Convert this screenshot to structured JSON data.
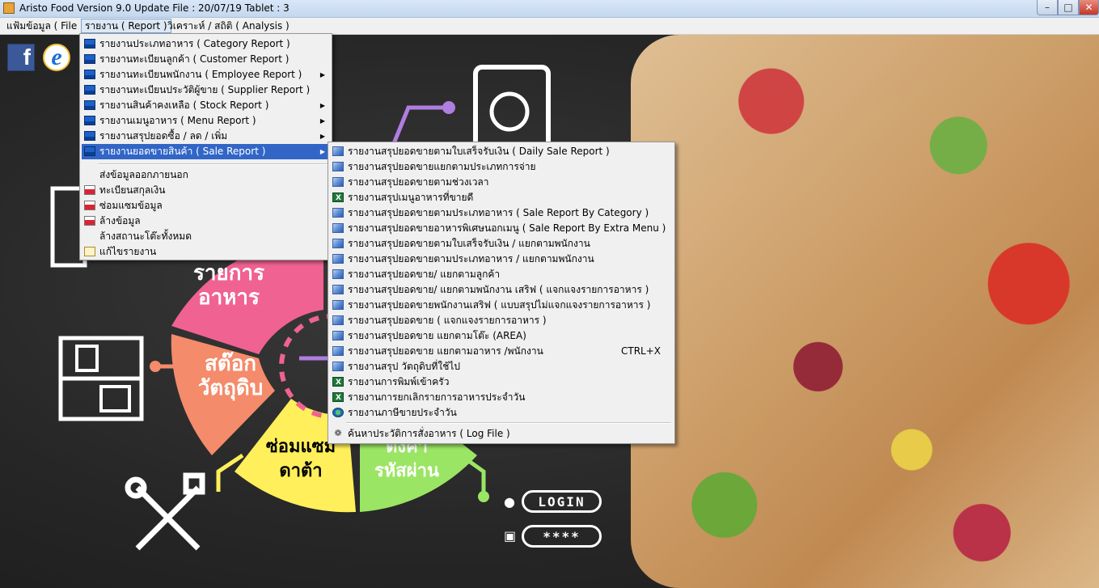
{
  "window": {
    "title": "Aristo Food  Version 9.0 Update File : 20/07/19 Tablet  : 3",
    "min_label": "–",
    "max_label": "□",
    "close_label": "✕"
  },
  "menubar": {
    "items": [
      {
        "label": "แฟ้มข้อมูล ( File )"
      },
      {
        "label": "รายงาน ( Report )"
      },
      {
        "label": "วิเคราะห์ / สถิติ ( Analysis )"
      }
    ]
  },
  "social": {
    "facebook": "f",
    "ie": "e"
  },
  "wheel": {
    "food_list": "รายการ\nอาหาร",
    "stock": "สต๊อก\nวัตถุดิบ",
    "repair": "ซ่อมแซม\nดาต้า",
    "password": "ตั้งค่า\nรหัสผ่าน"
  },
  "login": {
    "login_label": "LOGIN",
    "password_label": "****"
  },
  "report_menu": {
    "items": [
      {
        "label": "รายงานประเภทอาหาร ( Category Report )",
        "icon": "monitor-icon"
      },
      {
        "label": "รายงานทะเบียนลูกค้า ( Customer Report )",
        "icon": "monitor-icon"
      },
      {
        "label": "รายงานทะเบียนพนักงาน ( Employee Report )",
        "icon": "monitor-icon",
        "submenu": true
      },
      {
        "label": "รายงานทะเบียนประวัติผู้ขาย ( Supplier Report )",
        "icon": "monitor-icon"
      },
      {
        "label": "รายงานสินค้าคงเหลือ ( Stock Report )",
        "icon": "monitor-icon",
        "submenu": true
      },
      {
        "label": "รายงานเมนูอาหาร ( Menu Report )",
        "icon": "monitor-icon",
        "submenu": true
      },
      {
        "label": "รายงานสรุปยอดซื้อ / ลด / เพิ่ม",
        "icon": "monitor-icon",
        "submenu": true
      },
      {
        "label": "รายงานยอดขายสินค้า ( Sale Report )",
        "icon": "monitor-icon",
        "submenu": true,
        "highlighted": true
      },
      {
        "label": "ส่งข้อมูลออกภายนอก",
        "icon": ""
      },
      {
        "label": "ทะเบียนสกุลเงิน",
        "icon": "currency-icon"
      },
      {
        "label": "ซ่อมแซมข้อมูล",
        "icon": "repair-icon"
      },
      {
        "label": "ล้างข้อมูล",
        "icon": "clear-icon"
      },
      {
        "label": "ล้างสถานะโต๊ะทั้งหมด",
        "icon": ""
      },
      {
        "label": "แก้ไขรายงาน",
        "icon": "edit-icon"
      }
    ]
  },
  "sale_submenu": {
    "items": [
      {
        "label": "รายงานสรุปยอดขายตามใบเสร็จรับเงิน ( Daily Sale Report )",
        "icon": "cube"
      },
      {
        "label": "รายงานสรุปยอดขายแยกตามประเภทการจ่าย",
        "icon": "cube"
      },
      {
        "label": "รายงานสรุปยอดขายตามช่วงเวลา",
        "icon": "cube"
      },
      {
        "label": "รายงานสรุปเมนูอาหารที่ขายดี",
        "icon": "excel"
      },
      {
        "label": "รายงานสรุปยอดขายตามประเภทอาหาร ( Sale Report By Category )",
        "icon": "cube"
      },
      {
        "label": "รายงานสรุปยอดขายอาหารพิเศษนอกเมนู ( Sale Report By Extra Menu )",
        "icon": "cube"
      },
      {
        "label": "รายงานสรุปยอดขายตามใบเสร็จรับเงิน / แยกตามพนักงาน",
        "icon": "cube"
      },
      {
        "label": "รายงานสรุปยอดขายตามประเภทอาหาร / แยกตามพนักงาน",
        "icon": "cube"
      },
      {
        "label": "รายงานสรุปยอดขาย/ แยกตามลูกค้า",
        "icon": "cube"
      },
      {
        "label": "รายงานสรุปยอดขาย/ แยกตามพนักงาน เสริฟ ( แจกแจงรายการอาหาร )",
        "icon": "cube"
      },
      {
        "label": "รายงานสรุปยอดขายพนักงานเสริฟ ( แบบสรุปไม่แจกแจงรายการอาหาร )",
        "icon": "cube"
      },
      {
        "label": "รายงานสรุปยอดขาย ( แจกแจงรายการอาหาร )",
        "icon": "cube"
      },
      {
        "label": "รายงานสรุปยอดขาย แยกตามโต๊ะ   (AREA)",
        "icon": "cube"
      },
      {
        "label": "รายงานสรุปยอดขาย แยกตามอาหาร /พนักงาน",
        "icon": "cube",
        "shortcut": "CTRL+X"
      },
      {
        "label": "รายงานสรุป วัตถุดิบที่ใช้ไป",
        "icon": "cube"
      },
      {
        "label": "รายงานการพิมพ์เข้าครัว",
        "icon": "excel"
      },
      {
        "label": "รายงานการยกเลิกรายการอาหารประจำวัน",
        "icon": "excel"
      },
      {
        "label": "รายงานภาษีขายประจำวัน",
        "icon": "globe"
      },
      {
        "label": "ค้นหาประวัติการสั่งอาหาร ( Log File )",
        "icon": "log"
      }
    ]
  },
  "colors": {
    "highlight": "#3166c7",
    "pink": "#f06292",
    "orange": "#f48b6b",
    "yellow": "#ffef5a",
    "green": "#9be564",
    "purple": "#b07de0"
  }
}
